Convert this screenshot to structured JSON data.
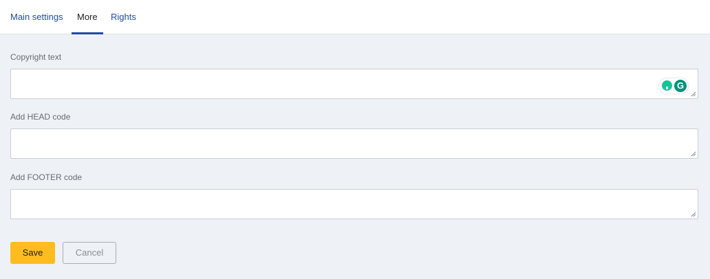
{
  "tabs": [
    {
      "label": "Main settings",
      "active": false
    },
    {
      "label": "More",
      "active": true
    },
    {
      "label": "Rights",
      "active": false
    }
  ],
  "fields": [
    {
      "label": "Copyright text",
      "value": ""
    },
    {
      "label": "Add HEAD code",
      "value": ""
    },
    {
      "label": "Add FOOTER code",
      "value": ""
    }
  ],
  "actions": {
    "save_label": "Save",
    "cancel_label": "Cancel"
  },
  "extension_icons": [
    "grammarly-suggestion-icon",
    "grammarly-logo-icon"
  ],
  "colors": {
    "link": "#1f4b9c",
    "primary_button": "#ffbc1f",
    "background": "#eef1f5"
  }
}
